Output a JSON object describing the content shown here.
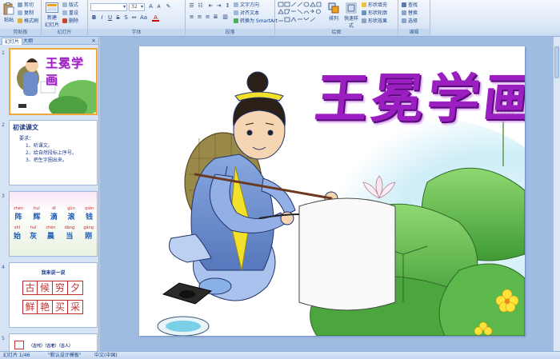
{
  "ribbon": {
    "clipboard": {
      "label": "剪贴板",
      "paste": "粘贴",
      "cut": "剪切",
      "copy": "复制",
      "format_painter": "格式刷"
    },
    "slides": {
      "label": "幻灯片",
      "new_slide": "新建",
      "new_slide2": "幻灯片",
      "layout": "版式",
      "reset": "重设",
      "delete": "删除"
    },
    "font": {
      "label": "字体",
      "font_name": "",
      "font_size": "32"
    },
    "paragraph": {
      "label": "段落",
      "text_direction": "文字方向",
      "align_text": "对齐文本",
      "smartart": "转换为 SmartArt"
    },
    "drawing": {
      "label": "绘图",
      "arrange": "排列",
      "quick_styles": "快速样式",
      "shape_fill": "形状填充",
      "shape_outline": "形状轮廓",
      "shape_effects": "形状效果"
    },
    "editing": {
      "label": "编辑",
      "find": "查找",
      "replace": "替换",
      "select": "选择"
    }
  },
  "panel": {
    "tab_slides": "幻灯片",
    "tab_outline": "大纲",
    "close": "×"
  },
  "thumbs": {
    "s1": {
      "num": "1",
      "title": "王冕学画"
    },
    "s2": {
      "num": "2",
      "title": "初读课文",
      "lead": "要求：",
      "items": [
        "1、听课文。",
        "2、给自然段标上序号。",
        "3、把生字圈出来。"
      ]
    },
    "s3": {
      "num": "3",
      "row1": [
        [
          "zhèn",
          "阵"
        ],
        [
          "huī",
          "辉"
        ],
        [
          "dī",
          "滴"
        ],
        [
          "gǔn",
          "滚"
        ],
        [
          "qián",
          "钱"
        ]
      ],
      "row2": [
        [
          "shǐ",
          "始"
        ],
        [
          "huī",
          "灰"
        ],
        [
          "chén",
          "晨"
        ],
        [
          "dāng",
          "当"
        ],
        [
          "gāng",
          "刚"
        ]
      ]
    },
    "s4": {
      "num": "4",
      "title": "我来说一说",
      "row1": [
        "古",
        "候",
        "穷",
        "夕"
      ],
      "row2": [
        "鲜",
        "艳",
        "买",
        "采"
      ]
    },
    "s5": {
      "num": "5",
      "partial": "（古代）（古老）（古人）"
    }
  },
  "slide": {
    "title": "王冕学画"
  },
  "status": {
    "slide_info": "幻灯片 1/46",
    "theme": "\"默认设计模板\"",
    "language": "中文(中国)"
  },
  "colors": {
    "title_purple": "#9b1fc0",
    "ribbon_text": "#15428b",
    "selection": "#f3a738"
  }
}
